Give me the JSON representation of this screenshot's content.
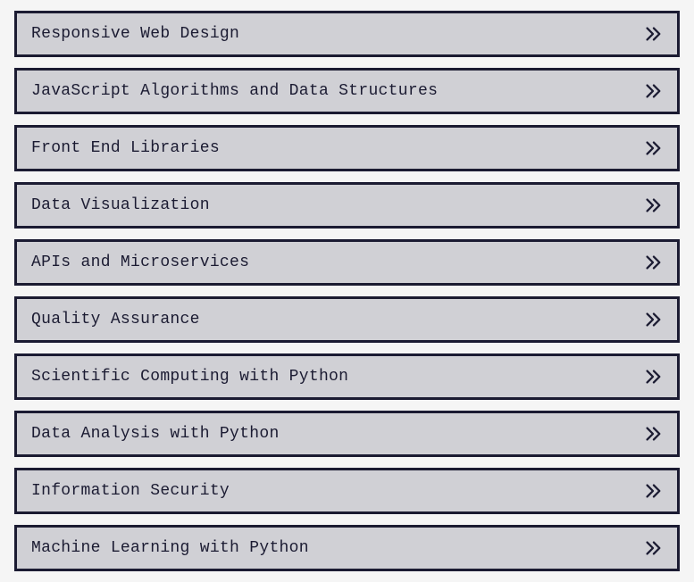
{
  "courses": [
    {
      "label": "Responsive Web Design"
    },
    {
      "label": "JavaScript Algorithms and Data Structures"
    },
    {
      "label": "Front End Libraries"
    },
    {
      "label": "Data Visualization"
    },
    {
      "label": "APIs and Microservices"
    },
    {
      "label": "Quality Assurance"
    },
    {
      "label": "Scientific Computing with Python"
    },
    {
      "label": "Data Analysis with Python"
    },
    {
      "label": "Information Security"
    },
    {
      "label": "Machine Learning with Python"
    }
  ]
}
